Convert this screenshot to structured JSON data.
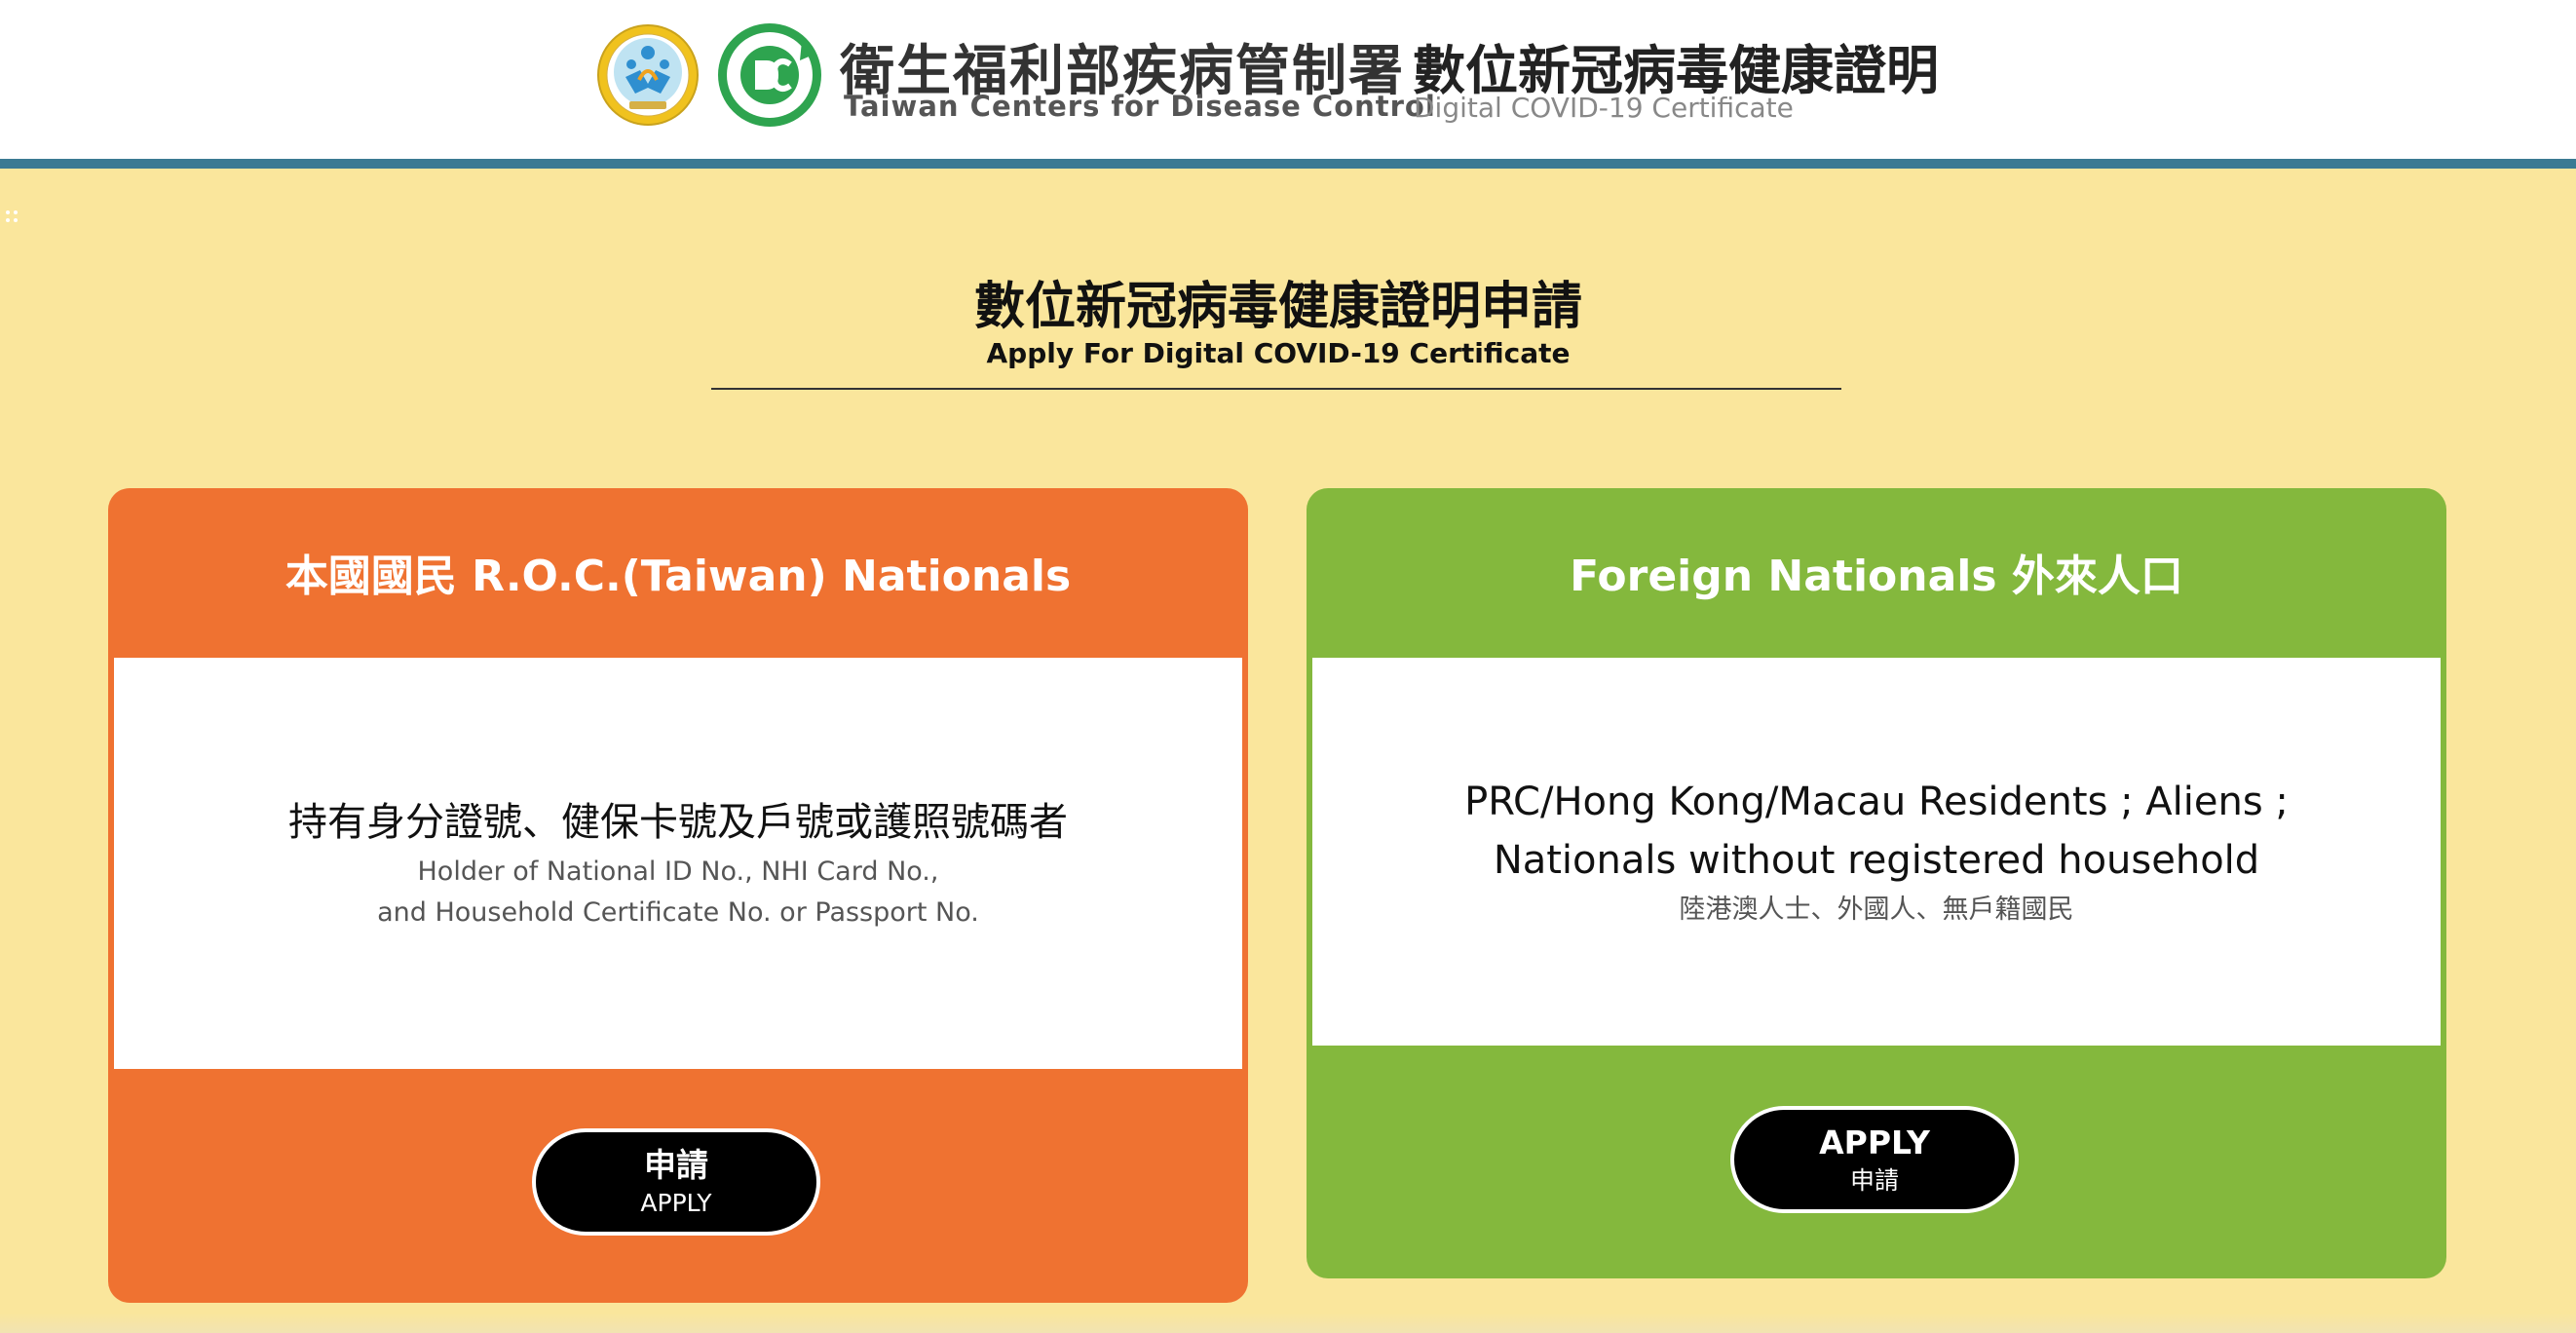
{
  "header": {
    "org_name_zh": "衛生福利部疾病管制署",
    "org_name_en": "Taiwan Centers for Disease Control",
    "site_title_zh": "數位新冠病毒健康證明",
    "site_title_en": "Digital COVID-19 Certificate"
  },
  "icons": {
    "seal": "government-seal-icon",
    "cdc_logo": "cdc-logo-icon",
    "drag_handle": "drag-handle-icon"
  },
  "section": {
    "title_zh": "數位新冠病毒健康證明申請",
    "title_en": "Apply For Digital COVID-19 Certificate"
  },
  "cards": {
    "roc": {
      "heading": "本國國民 R.O.C.(Taiwan) Nationals",
      "desc_main": "持有身分證號、健保卡號及戶號或護照號碼者",
      "desc_sub_1": "Holder of National ID No., NHI Card No.,",
      "desc_sub_2": "and Household Certificate No. or Passport No.",
      "button_line1": "申請",
      "button_line2": "APPLY"
    },
    "foreign": {
      "heading": "Foreign Nationals 外來人口",
      "desc_main_1": "PRC/Hong Kong/Macau Residents ; Aliens ;",
      "desc_main_2": "Nationals without registered household",
      "desc_sub": "陸港澳人士、外國人、無戶籍國民",
      "button_line1": "APPLY",
      "button_line2": "申請"
    }
  },
  "colors": {
    "page_background": "#fae69c",
    "header_bar": "#3b7a93",
    "roc_card": "#ef7231",
    "foreign_card": "#84b83d",
    "button": "#000000"
  }
}
